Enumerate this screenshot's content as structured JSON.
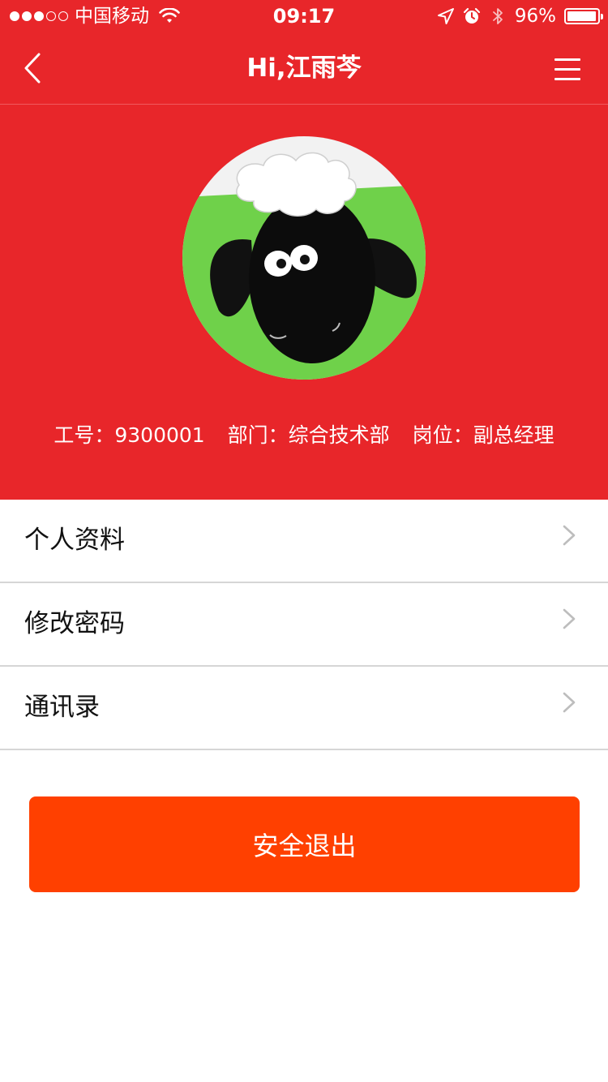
{
  "status_bar": {
    "signal_dots_filled": 3,
    "signal_dots_total": 5,
    "carrier": "中国移动",
    "time": "09:17",
    "battery_percent": "96%",
    "battery_level": 0.96,
    "icons": [
      "wifi-icon",
      "location-arrow-icon",
      "alarm-icon",
      "bluetooth-icon",
      "battery-icon"
    ]
  },
  "nav": {
    "title": "Hi,江雨芩",
    "back_icon": "chevron-left-icon",
    "menu_icon": "hamburger-menu-icon"
  },
  "profile": {
    "avatar_description_icon": "sheep-avatar",
    "employee_id": "工号：9300001",
    "department": "部门：综合技术部",
    "position": "岗位：副总经理"
  },
  "menu": {
    "items": [
      {
        "label": "个人资料",
        "icon": "chevron-right-icon"
      },
      {
        "label": "修改密码",
        "icon": "chevron-right-icon"
      },
      {
        "label": "通讯录",
        "icon": "chevron-right-icon"
      }
    ]
  },
  "logout": {
    "label": "安全退出"
  },
  "colors": {
    "header_red": "#e8262a",
    "logout_orange": "#ff4000",
    "divider": "#d6d6d6",
    "chevron": "#bdbdbd",
    "avatar_green": "#6fd14a"
  }
}
